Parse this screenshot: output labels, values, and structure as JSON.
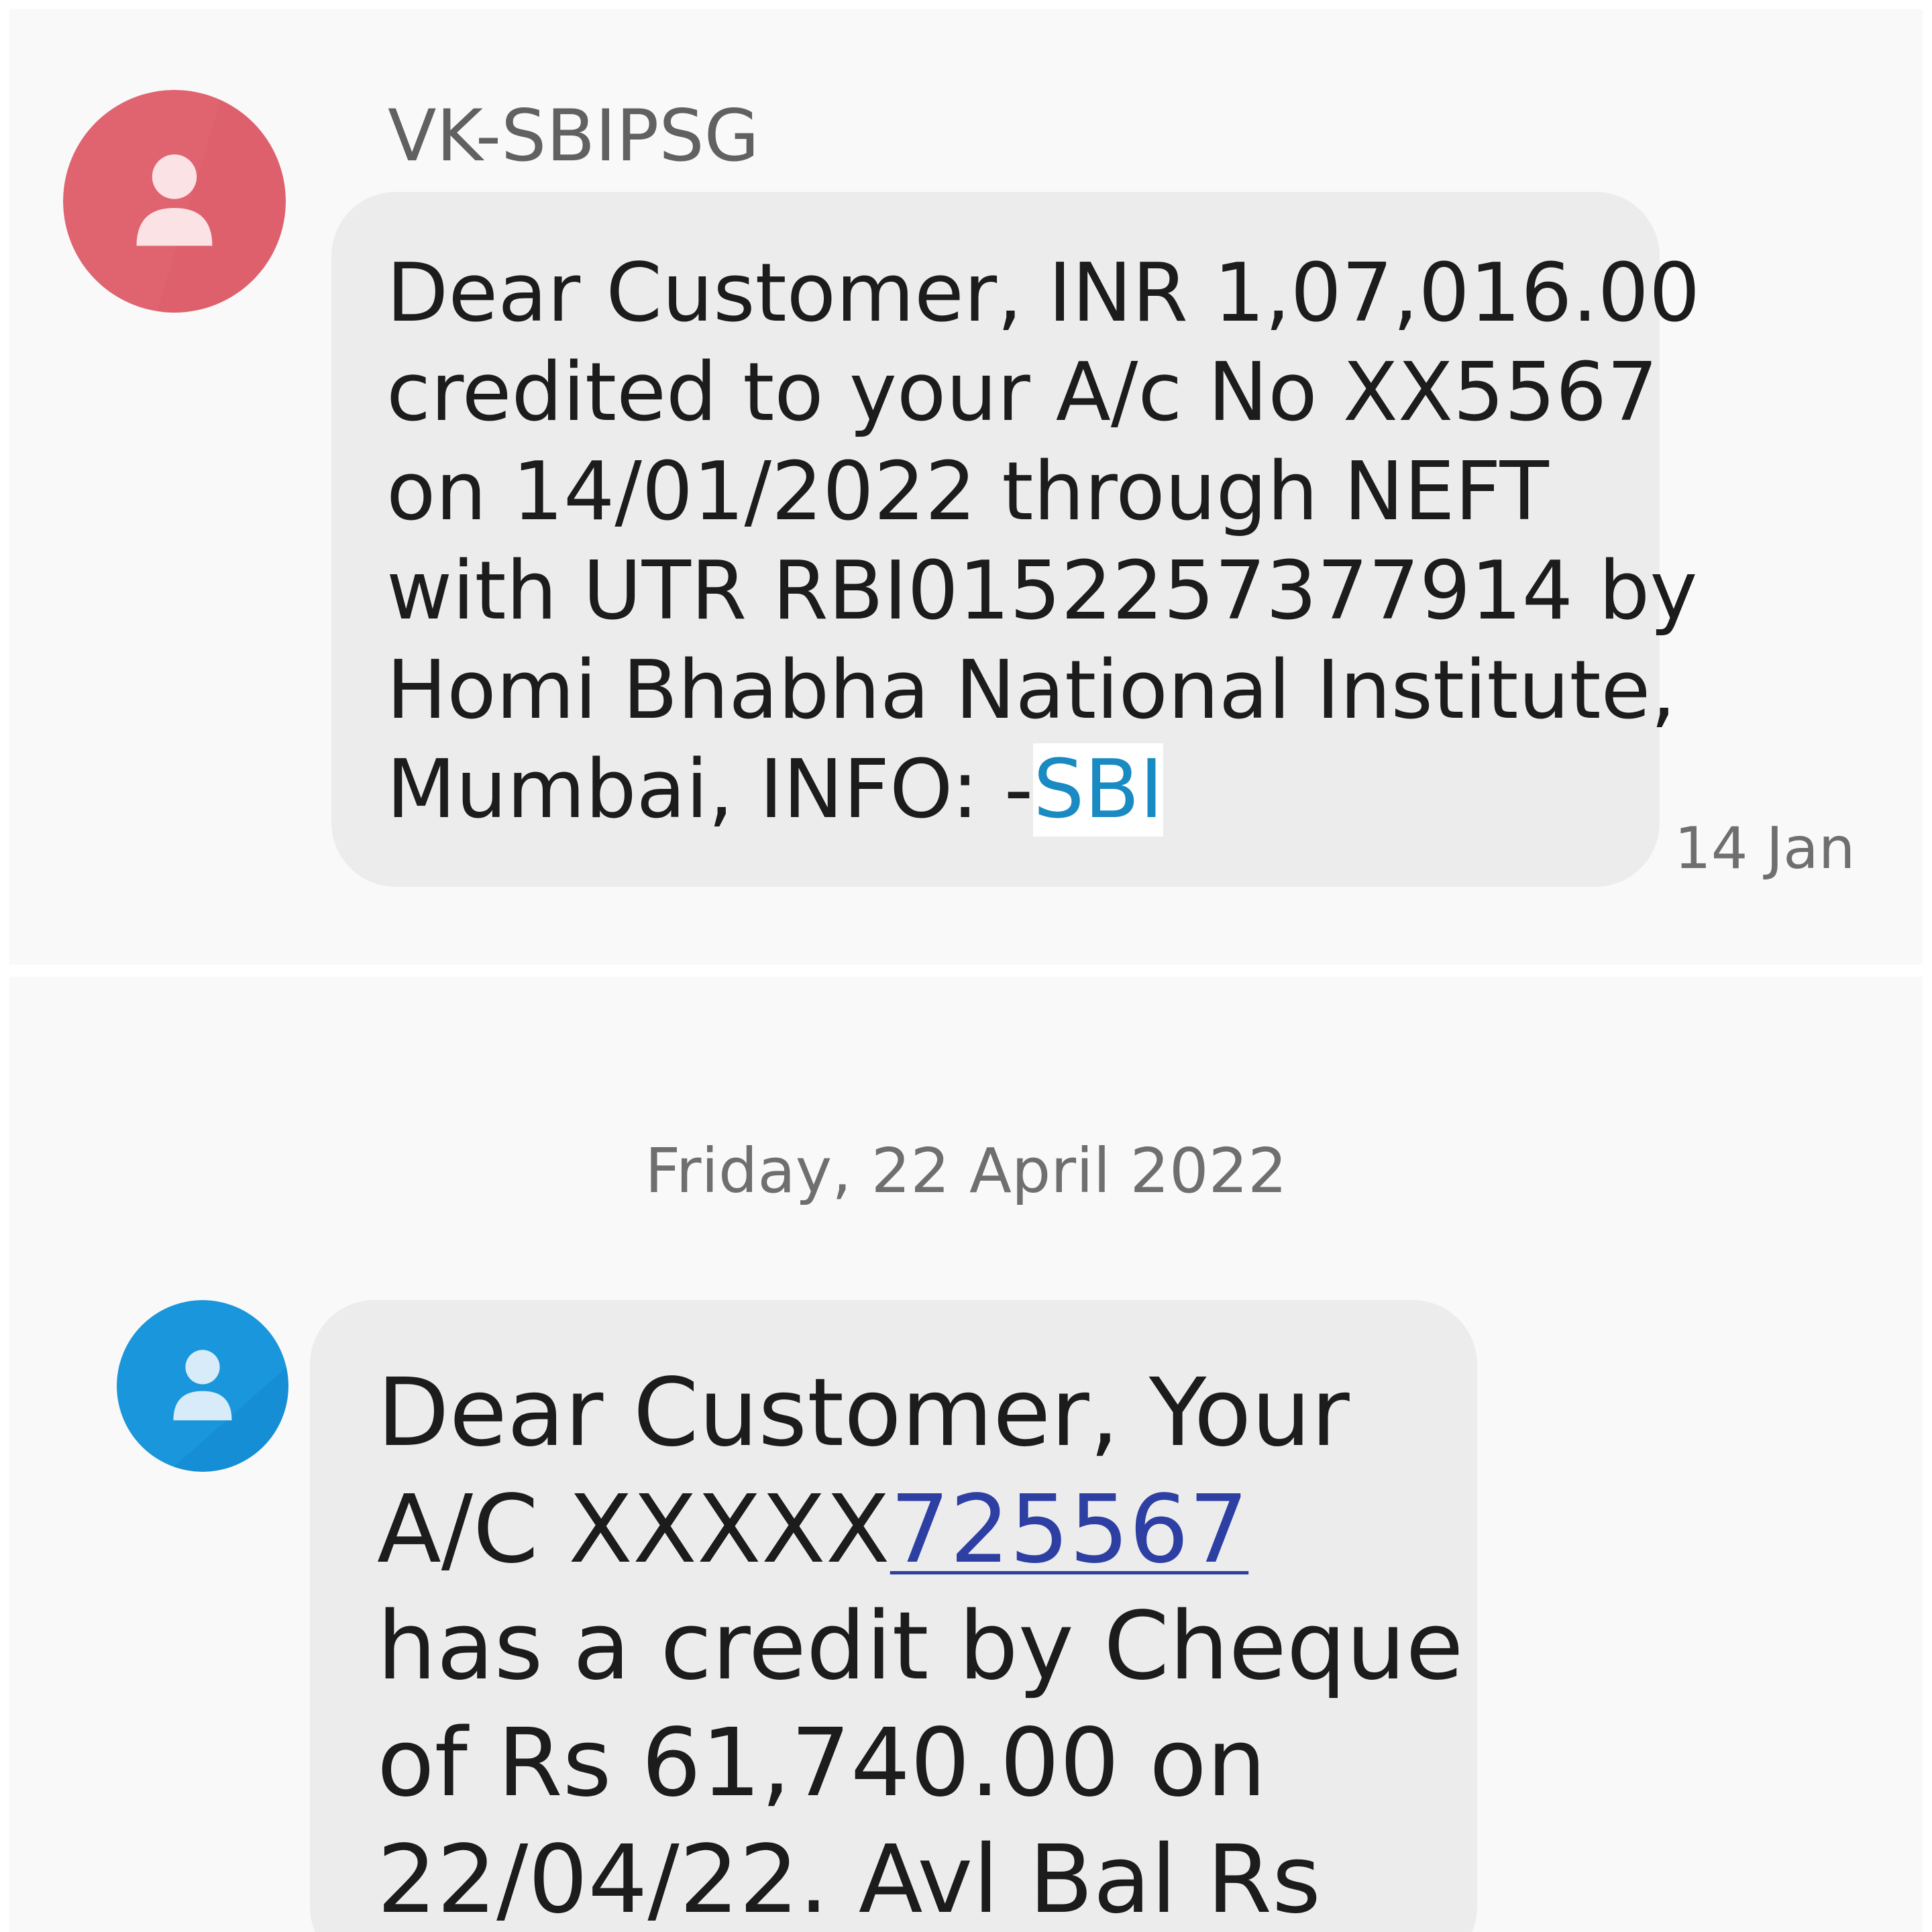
{
  "colors": {
    "sender_avatar_1": "#e06470",
    "sender_avatar_2": "#1a96dc",
    "bubble_background": "#ececec",
    "link_sbi": "#1a8ac2",
    "link_account": "#2e3fa3",
    "page_background": "#f9f9f9"
  },
  "icons": {
    "avatar": "person-icon"
  },
  "thread": {
    "sender_name": "VK-SBIPSG",
    "message_1": {
      "lines": [
        "Dear Customer, INR 1,07,016.00",
        "credited to your A/c No XX5567",
        "on 14/01/2022 through NEFT",
        "with UTR RBI0152257377914 by",
        "Homi Bhabha National Institute,"
      ],
      "last_line_prefix": "Mumbai, INFO: -",
      "link_text": "SBI",
      "timestamp": "14 Jan"
    },
    "date_separator": "Friday, 22 April 2022",
    "message_2": {
      "line_1": "Dear Customer, Your",
      "account_prefix": "A/C XXXXX",
      "account_link": "725567",
      "lines": [
        "has a credit by Cheque",
        "of Rs 61,740.00 on",
        "22/04/22. Avl Bal Rs"
      ]
    }
  }
}
